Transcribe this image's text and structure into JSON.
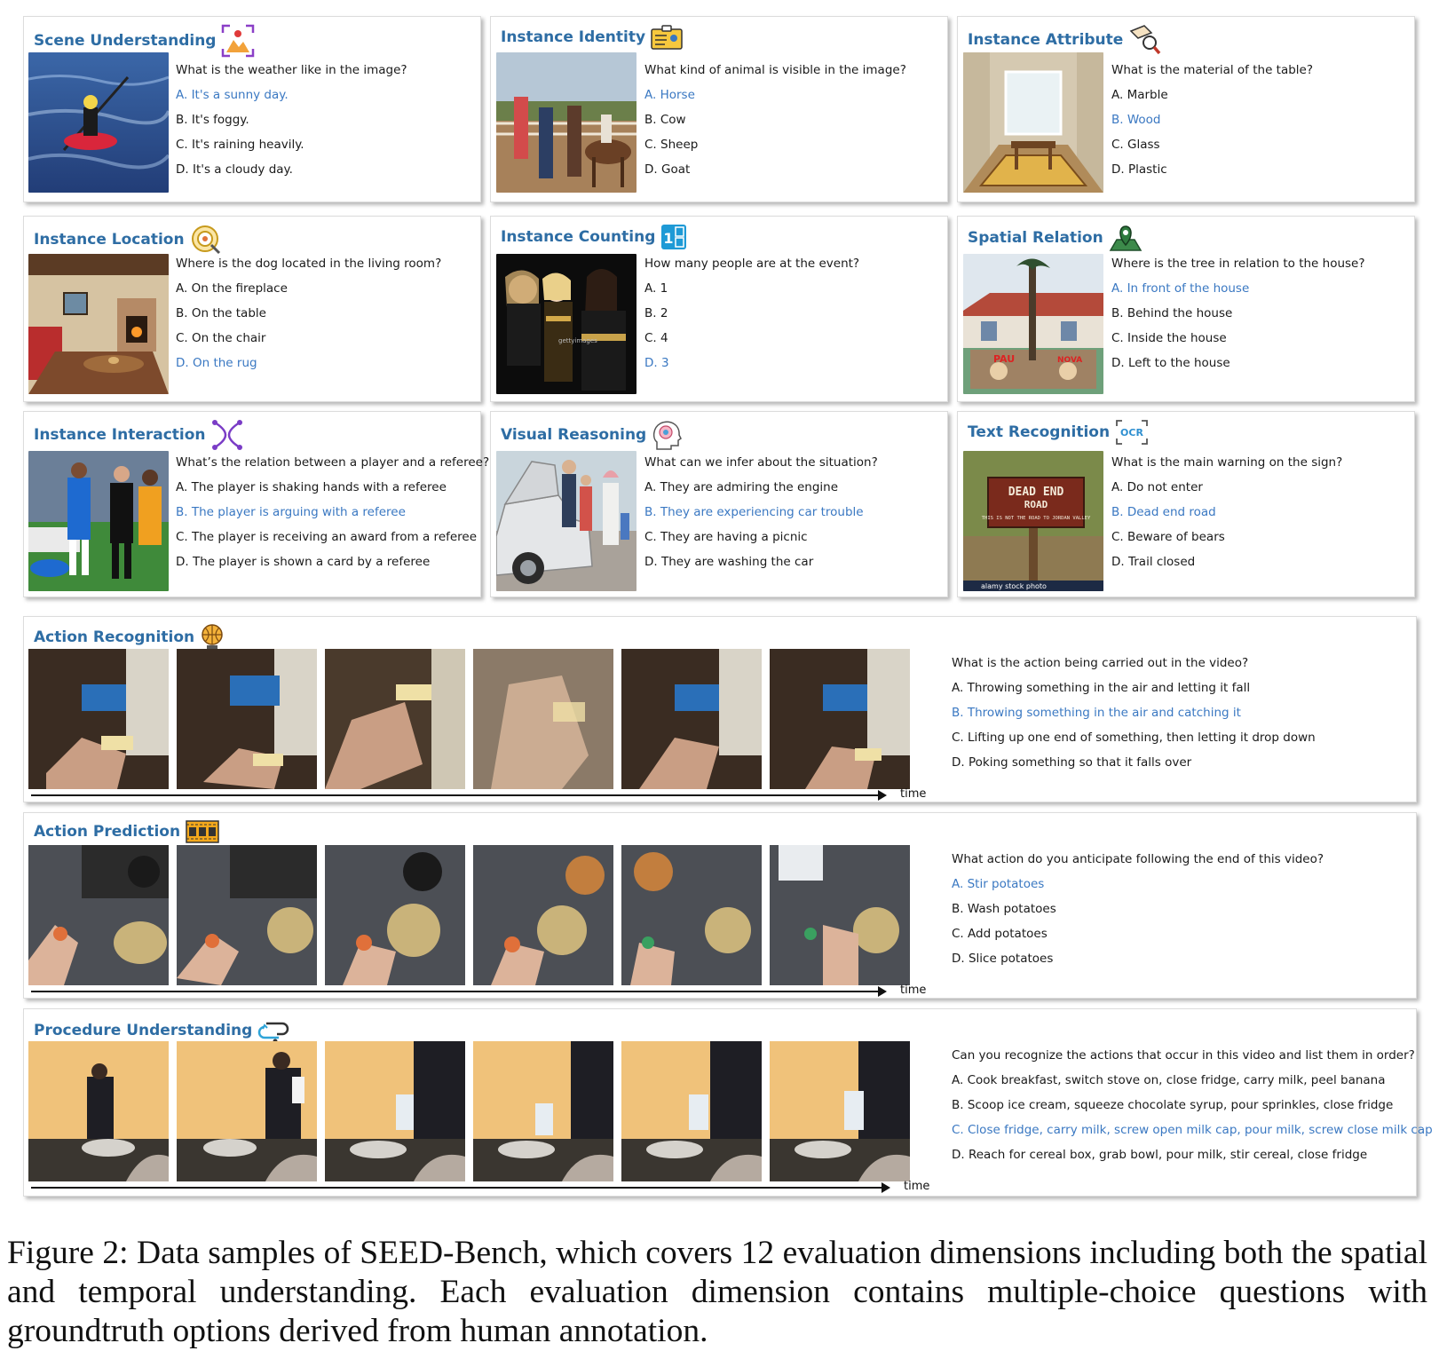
{
  "panels": [
    {
      "title": "Scene Understanding",
      "icon": "scene-icon",
      "question": "What is the weather like in the image?",
      "options": [
        "A. It's a sunny day.",
        "B. It's foggy.",
        "C. It's raining heavily.",
        "D. It's a cloudy day."
      ],
      "answer": 0
    },
    {
      "title": "Instance Identity",
      "icon": "id-card-icon",
      "question": "What kind of animal is visible in the image?",
      "options": [
        "A. Horse",
        "B. Cow",
        "C. Sheep",
        "D. Goat"
      ],
      "answer": 0
    },
    {
      "title": "Instance Attribute",
      "icon": "magnifier-tag-icon",
      "question": "What is the material of the table?",
      "options": [
        "A. Marble",
        "B. Wood",
        "C. Glass",
        "D. Plastic"
      ],
      "answer": 1
    },
    {
      "title": "Instance Location",
      "icon": "location-target-icon",
      "question": "Where is the dog located in the living room?",
      "options": [
        "A. On the fireplace",
        "B. On the table",
        "C. On the chair",
        "D. On the rug"
      ],
      "answer": 3
    },
    {
      "title": "Instance Counting",
      "icon": "counting-icon",
      "question": "How many people are at the event?",
      "options": [
        "A. 1",
        "B. 2",
        "C. 4",
        "D. 3"
      ],
      "answer": 3
    },
    {
      "title": "Spatial Relation",
      "icon": "map-pin-icon",
      "question": "Where is the tree in relation to the house?",
      "options": [
        "A. In front of the house",
        "B. Behind the house",
        "C. Inside the house",
        "D. Left to the house"
      ],
      "answer": 0
    },
    {
      "title": "Instance Interaction",
      "icon": "interaction-icon",
      "question": "What’s the relation between a player and a referee?",
      "options": [
        "A. The player is shaking hands with a referee",
        "B. The player is arguing with a referee",
        "C. The player is receiving an award from a referee",
        "D. The player is shown a card by a referee"
      ],
      "answer": 1
    },
    {
      "title": "Visual Reasoning",
      "icon": "brain-head-icon",
      "question": "What can we infer about the situation?",
      "options": [
        "A. They are admiring the engine",
        "B. They are experiencing car trouble",
        "C. They are having a picnic",
        "D. They are washing the car"
      ],
      "answer": 1
    },
    {
      "title": "Text Recognition",
      "icon": "ocr-icon",
      "question": "What is the main warning on the sign?",
      "options": [
        "A. Do not enter",
        "B. Dead end road",
        "C. Beware of bears",
        "D. Trail closed"
      ],
      "answer": 1
    }
  ],
  "videos": [
    {
      "title": "Action Recognition",
      "icon": "basketball-icon",
      "question": "What is the action being carried out in the video?",
      "options": [
        "A. Throwing something in the air and letting it fall",
        "B. Throwing something in the air and catching it",
        "C. Lifting up one end of something, then letting it drop down",
        "D. Poking something so that it falls over"
      ],
      "answer": 1,
      "time_label": "time"
    },
    {
      "title": "Action Prediction",
      "icon": "film-strip-icon",
      "question": "What action do you anticipate following the end of this video?",
      "options": [
        "A. Stir potatoes",
        "B. Wash potatoes",
        "C. Add potatoes",
        "D. Slice potatoes"
      ],
      "answer": 0,
      "time_label": "time"
    },
    {
      "title": "Procedure Understanding",
      "icon": "procedure-icon",
      "question": "Can you recognize the actions that occur in this video and list them in order?",
      "options": [
        "A. Cook breakfast, switch stove on, close fridge, carry milk, peel banana",
        "B. Scoop ice cream, squeeze chocolate syrup, pour sprinkles, close fridge",
        "C. Close fridge, carry milk, screw open milk cap, pour milk, screw close milk cap",
        "D. Reach for cereal box, grab bowl, pour milk, stir cereal, close fridge"
      ],
      "answer": 2,
      "time_label": "time"
    }
  ],
  "image_text": {
    "sign_line1": "DEAD END",
    "sign_line2": "ROAD",
    "sign_line3": "THIS IS NOT THE ROAD TO JORDAN VALLEY",
    "watermark": "alamy stock photo",
    "counting_watermark": "gettyimages",
    "mural_left": "PAU",
    "mural_right": "NOVA",
    "ocr_icon_text": "OCR",
    "count_icon_digit": "1"
  },
  "caption": "Figure 2: Data samples of SEED-Bench, which covers 12 evaluation dimensions including both the spatial and temporal understanding. Each evaluation dimension contains multiple-choice questions with groundtruth options derived from human annotation.",
  "colors": {
    "title": "#2e6da4",
    "correct": "#3a78c2",
    "text": "#1a1a1a"
  }
}
